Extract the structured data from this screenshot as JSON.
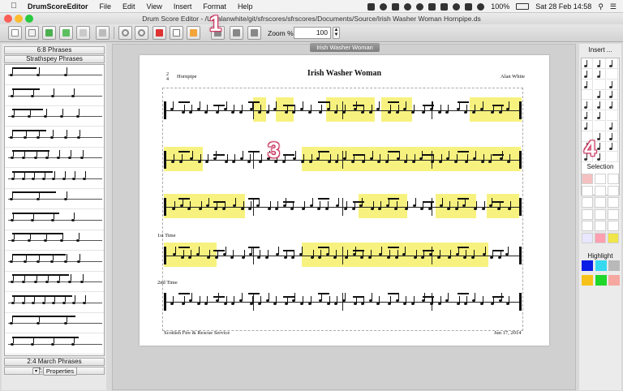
{
  "menubar": {
    "app_name": "DrumScoreEditor",
    "items": [
      "File",
      "Edit",
      "View",
      "Insert",
      "Format",
      "Help"
    ],
    "battery": "100%",
    "clock": "Sat 28 Feb  14:58"
  },
  "window": {
    "title": "Drum Score Editor - /Us  alanwhite/git/sfrscores/sfrscores/Documents/Source/Irish Washer Woman Hornpipe.ds"
  },
  "toolbar": {
    "zoom_label": "Zoom %",
    "zoom_value": "100"
  },
  "annotations": [
    "1",
    "2",
    "3",
    "4"
  ],
  "left_panel": {
    "top_buttons": [
      "6:8 Phrases",
      "Strathspey Phrases"
    ],
    "bottom_buttons": [
      "2:4 March Phrases",
      "2:4 Endings"
    ],
    "properties_label": "Properties"
  },
  "document": {
    "tab_label": "Irish Washer Woman",
    "title": "Irish Washer Woman",
    "tune_type": "Hornpipe",
    "composer": "Alan White",
    "time_sig_top": "2",
    "time_sig_bottom": "4",
    "first_time": "1st Time",
    "second_time": "2nd Time",
    "footer_left": "Scottish Fire & Rescue Service",
    "footer_right": "Jun 17, 2014"
  },
  "right_panel": {
    "insert_label": "Insert ...",
    "selection_label": "Selection",
    "highlight_label": "Highlight",
    "highlight_colors": [
      "#0a1ee6",
      "#35d9f0",
      "#b9b9b9",
      "#f6c21a",
      "#1fd62b",
      "#f5a7a0"
    ]
  },
  "colors": {
    "highlight_yellow": "#f7f27f",
    "annotation_pink": "#d23b64"
  }
}
